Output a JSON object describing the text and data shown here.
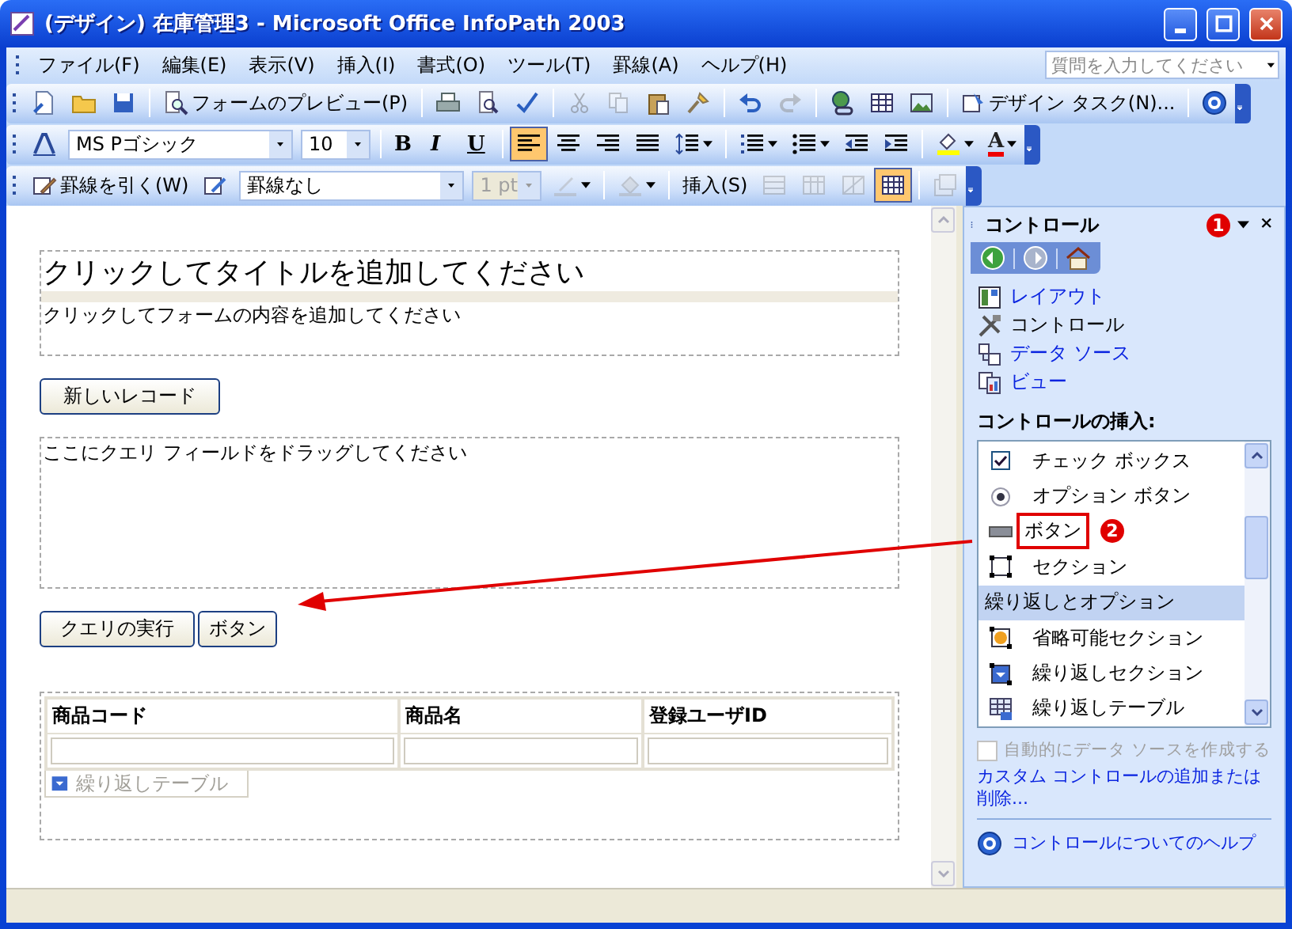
{
  "window": {
    "title": "(デザイン) 在庫管理3 - Microsoft Office InfoPath 2003"
  },
  "menu": [
    "ファイル(F)",
    "編集(E)",
    "表示(V)",
    "挿入(I)",
    "書式(O)",
    "ツール(T)",
    "罫線(A)",
    "ヘルプ(H)"
  ],
  "help_search": {
    "placeholder": "質問を入力してください"
  },
  "toolbars": [
    {
      "items": [
        {
          "kind": "new"
        },
        {
          "kind": "open"
        },
        {
          "kind": "save"
        },
        {
          "kind": "sep"
        },
        {
          "kind": "preview",
          "label": "フォームのプレビュー(P)"
        },
        {
          "kind": "sep"
        },
        {
          "kind": "print"
        },
        {
          "kind": "print-preview"
        },
        {
          "kind": "spelling"
        },
        {
          "kind": "sep"
        },
        {
          "kind": "cut",
          "disabled": true
        },
        {
          "kind": "copy",
          "disabled": true
        },
        {
          "kind": "paste"
        },
        {
          "kind": "painter"
        },
        {
          "kind": "sep"
        },
        {
          "kind": "undo"
        },
        {
          "kind": "redo",
          "disabled": true
        },
        {
          "kind": "sep"
        },
        {
          "kind": "hyperlink"
        },
        {
          "kind": "table"
        },
        {
          "kind": "picture"
        },
        {
          "kind": "sep"
        },
        {
          "kind": "design-tasks",
          "label": "デザイン タスク(N)..."
        },
        {
          "kind": "sep"
        },
        {
          "kind": "help"
        }
      ]
    },
    {
      "items": [
        {
          "kind": "style"
        },
        {
          "kind": "font-combo",
          "value": "MS Pゴシック"
        },
        {
          "kind": "size-combo",
          "value": "10"
        },
        {
          "kind": "sep"
        },
        {
          "kind": "bold",
          "label": "B"
        },
        {
          "kind": "italic",
          "label": "I"
        },
        {
          "kind": "underline",
          "label": "U"
        },
        {
          "kind": "sep"
        },
        {
          "kind": "align-left",
          "selected": true
        },
        {
          "kind": "align-center",
          "selected": false
        },
        {
          "kind": "align-right",
          "selected": false
        },
        {
          "kind": "justify",
          "selected": false
        },
        {
          "kind": "line-spacing",
          "dropdown": true
        },
        {
          "kind": "sep"
        },
        {
          "kind": "numbering",
          "dropdown": true
        },
        {
          "kind": "bullets",
          "dropdown": true
        },
        {
          "kind": "outdent"
        },
        {
          "kind": "indent"
        },
        {
          "kind": "sep"
        },
        {
          "kind": "highlight",
          "dropdown": true
        },
        {
          "kind": "font-color",
          "label": "A",
          "dropdown": true
        }
      ]
    },
    {
      "items": [
        {
          "kind": "draw-table",
          "label": "罫線を引く(W)"
        },
        {
          "kind": "border"
        },
        {
          "kind": "border-combo",
          "value": "罫線なし"
        },
        {
          "kind": "width-combo",
          "value": "1 pt",
          "disabled": true
        },
        {
          "kind": "border-color",
          "disabled": true,
          "dropdown": true
        },
        {
          "kind": "sep"
        },
        {
          "kind": "shading",
          "disabled": true,
          "dropdown": true
        },
        {
          "kind": "sep"
        },
        {
          "kind": "insert-menu",
          "label": "挿入(S)"
        },
        {
          "kind": "table-rows",
          "disabled": true
        },
        {
          "kind": "table-cols",
          "disabled": true
        },
        {
          "kind": "split-cells",
          "disabled": true
        },
        {
          "kind": "table-grid",
          "selected": true
        },
        {
          "kind": "sep"
        },
        {
          "kind": "properties",
          "disabled": true
        }
      ]
    }
  ],
  "form": {
    "title_placeholder": "クリックしてタイトルを追加してください",
    "content_placeholder": "クリックしてフォームの内容を追加してください",
    "new_record_button": "新しいレコード",
    "query_placeholder": "ここにクエリ フィールドをドラッグしてください",
    "query_buttons": [
      {
        "label": "クエリの実行"
      },
      {
        "label": "ボタン"
      }
    ],
    "table": {
      "columns": [
        "商品コード",
        "商品名",
        "登録ユーザID"
      ],
      "repeat_tag": "繰り返しテーブル"
    }
  },
  "task_pane": {
    "title": "コントロール",
    "callout": "1",
    "nav": [
      {
        "kind": "back",
        "disabled": false
      },
      {
        "kind": "forward",
        "disabled": true
      },
      {
        "kind": "home",
        "disabled": false
      }
    ],
    "links": [
      {
        "kind": "layout",
        "label": "レイアウト",
        "selected": false
      },
      {
        "kind": "controls",
        "label": "コントロール",
        "selected": true
      },
      {
        "kind": "data-source",
        "label": "データ ソース",
        "selected": false
      },
      {
        "kind": "view",
        "label": "ビュー",
        "selected": false
      }
    ],
    "insert_heading": "コントロールの挿入:",
    "controls": [
      {
        "kind": "checkbox",
        "label": "チェック ボックス"
      },
      {
        "kind": "option",
        "label": "オプション ボタン"
      },
      {
        "kind": "button",
        "label": "ボタン",
        "annotated": true,
        "callout": "2"
      },
      {
        "kind": "section",
        "label": "セクション"
      },
      {
        "kind": "group",
        "label": "繰り返しとオプション"
      },
      {
        "kind": "optional-section",
        "label": "省略可能セクション"
      },
      {
        "kind": "repeating-section",
        "label": "繰り返しセクション"
      },
      {
        "kind": "repeating-table",
        "label": "繰り返しテーブル"
      }
    ],
    "auto_create": {
      "label": "自動的にデータ ソースを作成する",
      "checked": false,
      "disabled": true
    },
    "custom_link": "カスタム コントロールの追加または削除...",
    "help_link": "コントロールについてのヘルプ"
  }
}
